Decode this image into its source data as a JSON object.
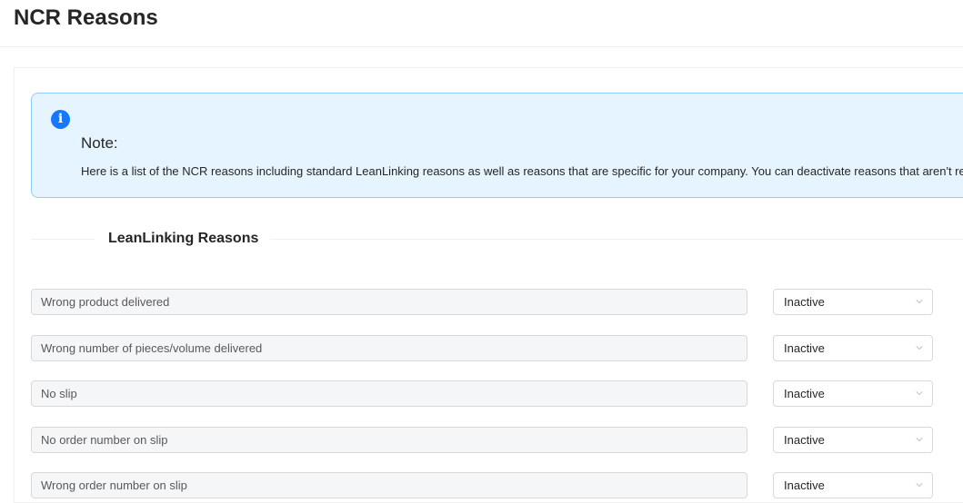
{
  "page": {
    "title": "NCR Reasons"
  },
  "note": {
    "title": "Note:",
    "description": "Here is a list of the NCR reasons including standard LeanLinking reasons as well as reasons that are specific for your company. You can deactivate reasons that aren't relevant fo"
  },
  "section": {
    "title": "LeanLinking Reasons"
  },
  "reasons": [
    {
      "label": "Wrong product delivered",
      "status": "Inactive"
    },
    {
      "label": "Wrong number of pieces/volume delivered",
      "status": "Inactive"
    },
    {
      "label": "No slip",
      "status": "Inactive"
    },
    {
      "label": "No order number on slip",
      "status": "Inactive"
    },
    {
      "label": "Wrong order number on slip",
      "status": "Inactive"
    }
  ],
  "colors": {
    "accent": "#1677ff",
    "alert_bg": "#e6f4ff",
    "alert_border": "#91caff"
  }
}
